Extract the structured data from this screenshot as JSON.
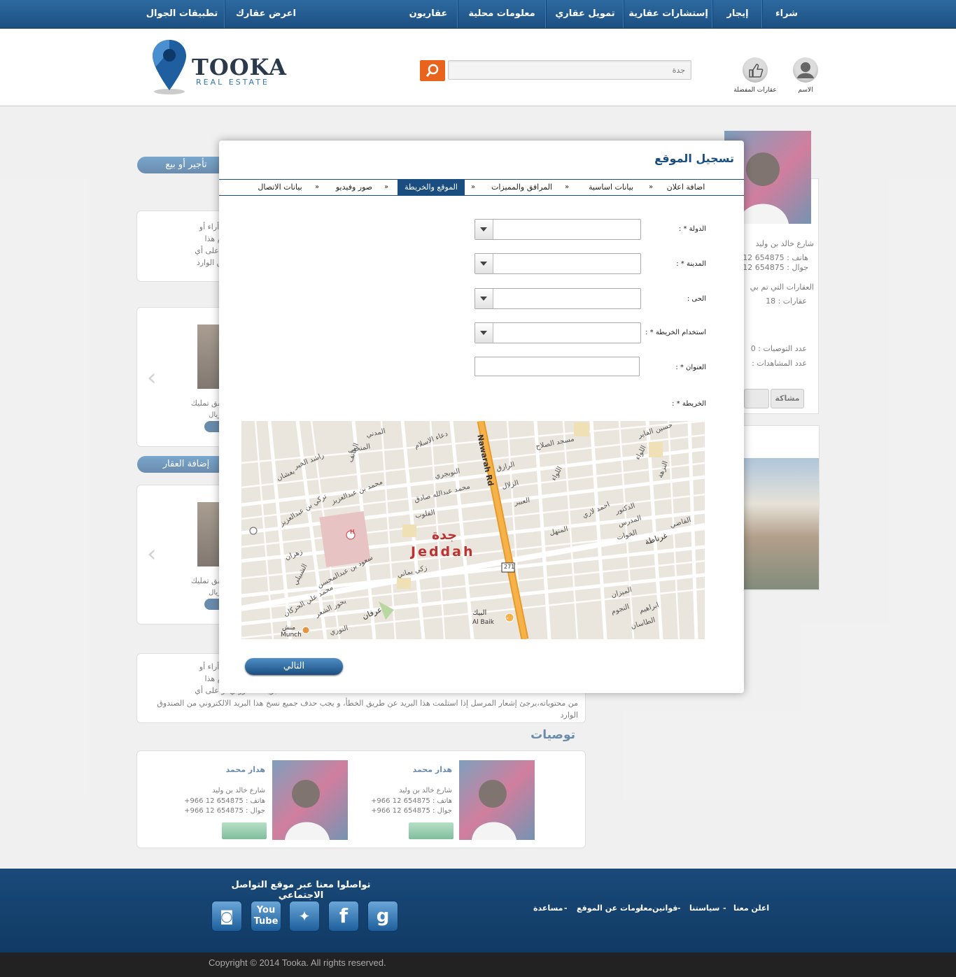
{
  "nav": {
    "items": [
      "شراء",
      "إيجار",
      "إستشارات عقارية",
      "تمويل عقاري",
      "معلومات محلية",
      "عقاريون",
      "اعرض  عقارك",
      "تطبيقات الجوال"
    ]
  },
  "header": {
    "logo_main": "TOOKA",
    "logo_sub": "REAL ESTATE",
    "search_placeholder": "جدة",
    "user_label": "الاسم",
    "favorites_label": "عقارات المفضلة"
  },
  "background": {
    "rent_or_sell": "تأجير أو بيع",
    "add_property": "إضافة العقار",
    "paragraph_lines": [
      "من محتوياته،يرجئ إشعار المرسل إذا استلمت هذا البريد عن طريق الخطأ،  و يجب حذف جميع نسخ هذا البريد الالكتروني من الصندوق الوارد"
    ],
    "para_snippets": [
      "مرسل إليهم إن أية أراء أو",
      "احد المعنيين باستلام هذا",
      "البريد الالكتروني أو على أي",
      "كتروني من الصندوق الوارد"
    ],
    "recommendations_title": "توصيات",
    "card": {
      "name": "هدار محمد",
      "address": "شارع خالد بن وليد",
      "phone": "هاتف : 654875 12 966+",
      "mobile": "جوال : 654875 12 966+"
    },
    "side": {
      "address": "شارع خالد بن وليد",
      "phone": "هاتف : 654875 12",
      "mobile": "جوال : 654875 12",
      "sold": "العقارات التي تم بي",
      "properties": "عقارات  :   18",
      "recommend_count": "عدد التوصيات : 0",
      "views_count": "عدد المشاهدات :",
      "share": "مشاكة"
    },
    "listing_name": "شقق تمليك",
    "listing_price": "ريال"
  },
  "modal": {
    "title": "تسجيل الموقع",
    "steps": [
      "اضافة اعلان",
      "بيانات اساسية",
      "المرافق والمميزات",
      "الموقع والخريطة",
      "صور وفيديو",
      "بيانات الاتصال"
    ],
    "active_step": "الموقع والخريطة",
    "fields": {
      "country": "الدولة * :",
      "city": "المدينة * :",
      "district": "الحى :",
      "use_map": "استخدام الخريطة * :",
      "address": "العنوان * :",
      "map": "الخريطة * :"
    },
    "next_button": "التالي",
    "map": {
      "city_ar": "جدة",
      "city_en": "Jeddah",
      "road": "Nawarah Rd",
      "route": "271",
      "baik_ar": "البيك",
      "baik_en": "Al Baik",
      "munch_ar": "منش",
      "munch_en": "Munch",
      "streets": [
        "دعاء الاسلام",
        "النوبجري",
        "محمد عبدالله صادق",
        "تركي بن عبدالعزيز",
        "القلوب",
        "الرازق",
        "الزلال",
        "العبير",
        "مسجد الصلاح",
        "اللواء",
        "اللواء",
        "غرناطة",
        "الخوات",
        "المدرس",
        "الدكتور",
        "احمد لاري",
        "الميزان",
        "الطاسان",
        "ابراهيم",
        "النجوم",
        "عرفان",
        "زكي يماني",
        "سعود بن عبدالمحسن",
        "محمد علي الحركان",
        "بحور الشعر",
        "النوري",
        "زهران",
        "الشبيلي",
        "المنحنى",
        "المدني",
        "راشد الخير",
        "بغشان",
        "محمد بن عبدالعزيز",
        "الجانف",
        "حسين الفاير",
        "النزهة",
        "القاضي",
        "المنهل"
      ]
    }
  },
  "footer": {
    "social_title": "تواصلوا معنا عبر موقع التواصل الاجتماعي",
    "links": [
      "اعلن معنا",
      "سياستنا",
      "قوانين",
      "معلومات عن الموقع",
      "مساعدة"
    ],
    "link_separator": "-",
    "social": [
      "instagram-icon",
      "youtube-icon",
      "twitter-icon",
      "facebook-icon",
      "google-icon"
    ],
    "copyright": "Copyright © 2014 Tooka. All rights reserved."
  },
  "colors": {
    "nav": "#1c4f82",
    "accent": "#e8631b",
    "footer": "#103a64"
  }
}
